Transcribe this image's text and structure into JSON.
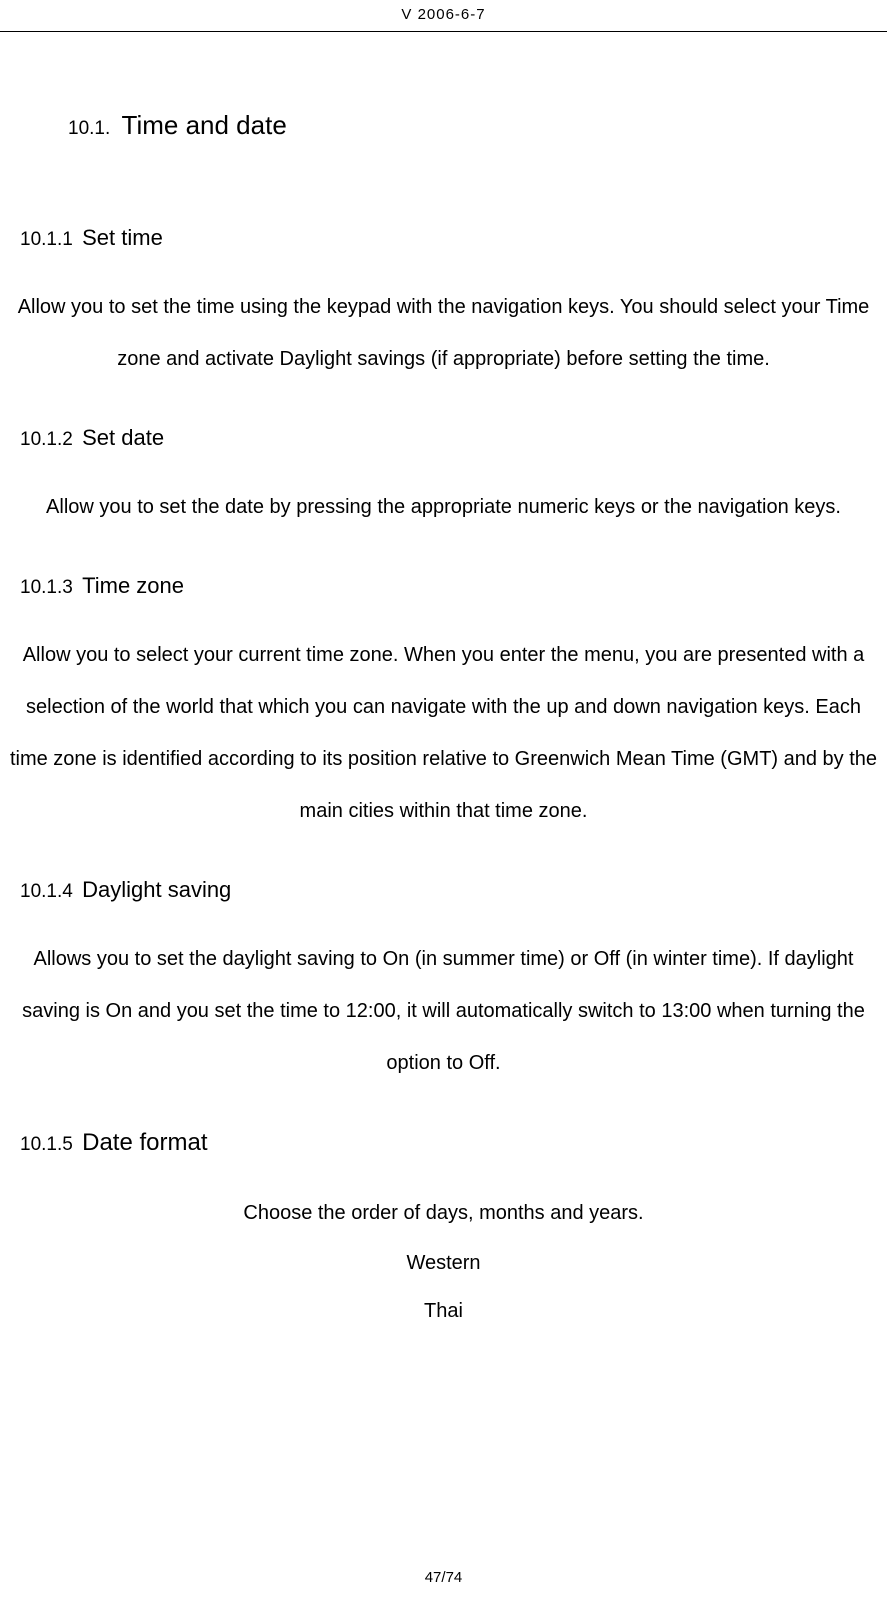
{
  "header": {
    "version_date": "V 2006-6-7"
  },
  "section": {
    "number": "10.1.",
    "title": "Time and date"
  },
  "subsections": {
    "s1": {
      "number": "10.1.1",
      "title": "Set time",
      "body": "Allow you to set the time using the keypad with the navigation keys. You should select your Time zone and activate Daylight savings (if appropriate) before setting the time."
    },
    "s2": {
      "number": "10.1.2",
      "title": "Set date",
      "body": "Allow you to set the date by pressing the appropriate numeric keys or the navigation keys."
    },
    "s3": {
      "number": "10.1.3",
      "title": "Time zone",
      "body": "Allow you to select your current time zone. When you enter the menu, you are presented with a selection of the world that which you can navigate with the up and down navigation keys. Each time zone is identified according to its position relative to Greenwich Mean Time (GMT) and by the main cities within that time zone."
    },
    "s4": {
      "number": "10.1.4",
      "title": "Daylight saving",
      "body": "Allows you to set the daylight saving to On (in summer time) or Off (in winter time). If daylight saving is On and you set the time to 12:00, it will automatically switch to 13:00 when turning the option to Off."
    },
    "s5": {
      "number": "10.1.5",
      "title": "Date format",
      "body": "Choose the order of days, months and years.",
      "options": {
        "o1": "Western",
        "o2": "Thai"
      }
    }
  },
  "footer": {
    "page": "47/74"
  }
}
